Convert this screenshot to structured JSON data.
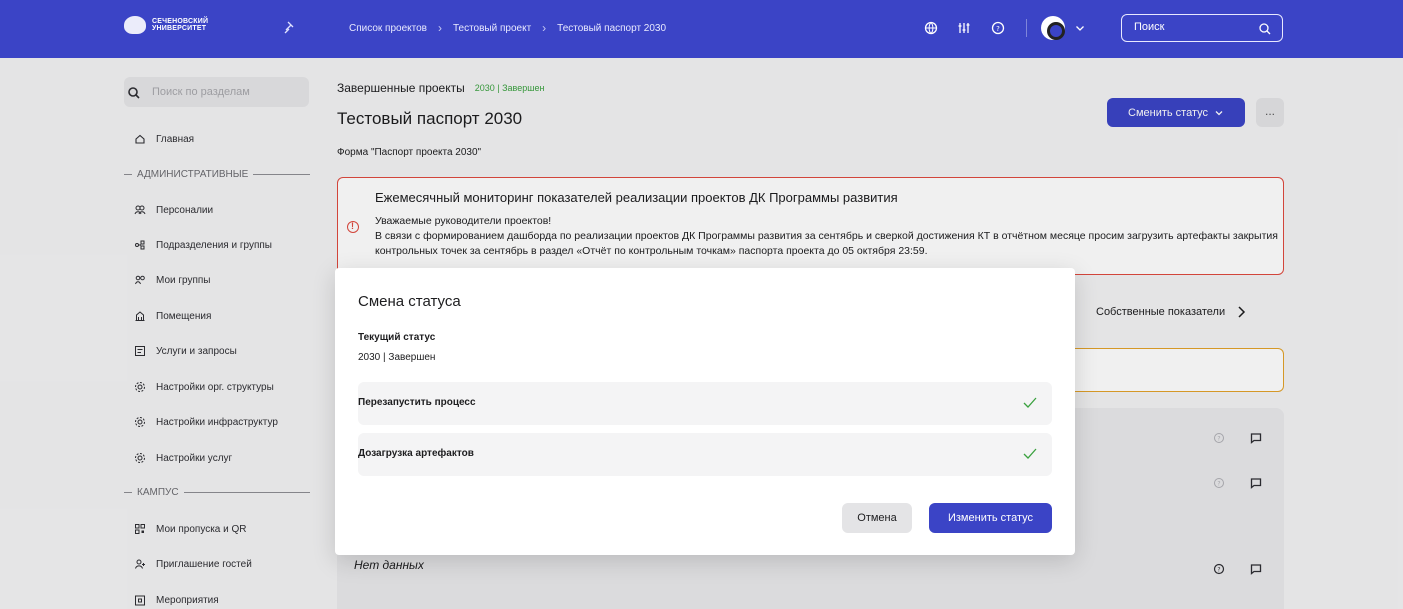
{
  "topbar": {
    "logo_line1": "СЕЧЕНОВСКИЙ",
    "logo_line2": "УНИВЕРСИТЕТ",
    "breadcrumbs": [
      "Список проектов",
      "Тестовый проект",
      "Тестовый паспорт 2030"
    ],
    "search_placeholder": "Поиск"
  },
  "sidebar": {
    "search_placeholder": "Поиск по разделам",
    "home": "Главная",
    "section_admin": "АДМИНИСТРАТИВНЫЕ",
    "admin_items": [
      "Персоналии",
      "Подразделения и группы",
      "Мои группы",
      "Помещения",
      "Услуги и запросы",
      "Настройки орг. структуры",
      "Настройки инфраструктур",
      "Настройки услуг"
    ],
    "section_campus": "КАМПУС",
    "campus_items": [
      "Мои пропуска и QR",
      "Приглашение гостей",
      "Мероприятия"
    ]
  },
  "main": {
    "subtitle": "Завершенные проекты",
    "status": "2030 | Завершен",
    "title": "Тестовый паспорт 2030",
    "change_status_button": "Сменить статус",
    "more_button": "...",
    "form_label": "Форма \"Паспорт проекта 2030\"",
    "alert": {
      "title": "Ежемесячный мониторинг показателей реализации проектов ДК Программы развития",
      "line1": "Уважаемые руководители проектов!",
      "line2": "В связи с формированием дашборда по реализации проектов ДК Программы развития за сентябрь и сверкой достижения КТ в отчётном месяце просим загрузить артефакты закрытия контрольных точек за сентябрь в раздел «Отчёт по контрольным точкам» паспорта проекта до 05 октября 23:59."
    },
    "own_metrics": "Собственные показатели",
    "no_data": "Нет данных"
  },
  "modal": {
    "title": "Смена статуса",
    "current_label": "Текущий статус",
    "current_value": "2030 | Завершен",
    "options": [
      "Перезапустить процесс",
      "Дозагрузка артефактов"
    ],
    "cancel": "Отмена",
    "apply": "Изменить статус"
  },
  "colors": {
    "brand": "#3b44c6",
    "success": "#3aa13f",
    "danger": "#e04a3f",
    "warning": "#e3a22a"
  }
}
